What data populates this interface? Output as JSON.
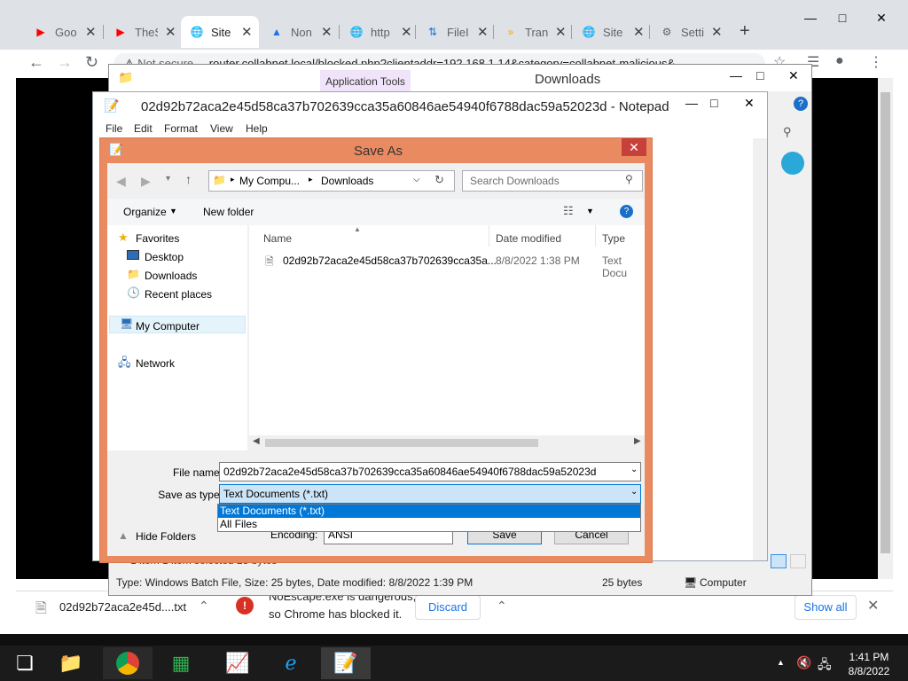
{
  "chrome": {
    "tabs": [
      {
        "title": "Goo",
        "icon": "youtube-icon",
        "color": "#ff0000"
      },
      {
        "title": "TheS",
        "icon": "youtube-icon",
        "color": "#ff0000"
      },
      {
        "title": "Site",
        "icon": "globe-icon",
        "color": "#5f6368"
      },
      {
        "title": "Non",
        "icon": "drive-icon",
        "color": "#1a73e8"
      },
      {
        "title": "http",
        "icon": "globe-icon",
        "color": "#5f6368"
      },
      {
        "title": "FileI",
        "icon": "transfer-icon",
        "color": "#1a73e8"
      },
      {
        "title": "Tran",
        "icon": "chevron-icon",
        "color": "#f9ab00"
      },
      {
        "title": "Site",
        "icon": "globe-icon",
        "color": "#5f6368"
      },
      {
        "title": "Setti",
        "icon": "gear-icon",
        "color": "#5f6368"
      }
    ],
    "security_label": "Not secure",
    "url": "router.collabnet.local/blocked.php?clientaddr=192.168.1.14&category=collabnet-malicious&"
  },
  "downloads_bar": {
    "file_name": "02d92b72aca2e45d....txt",
    "warning_line1": "NoEscape.exe is dangerous,",
    "warning_line2": "so Chrome has blocked it.",
    "discard_label": "Discard",
    "show_all_label": "Show all"
  },
  "explorer": {
    "app_tools_label": "Application Tools",
    "title": "Downloads",
    "status_text": "Type: Windows Batch File, Size: 25 bytes, Date modified: 8/8/2022 1:39 PM",
    "status_size": "25 bytes",
    "status_location": "Computer",
    "behind_text": "1 item     1 item selected  25 bytes"
  },
  "notepad": {
    "title": "02d92b72aca2e45d58ca37b702639cca35a60846ae54940f6788dac59a52023d - Notepad",
    "menus": [
      "File",
      "Edit",
      "Format",
      "View",
      "Help"
    ]
  },
  "save_as": {
    "title": "Save As",
    "breadcrumb": [
      "My Compu...",
      "Downloads"
    ],
    "search_placeholder": "Search Downloads",
    "organize_label": "Organize",
    "new_folder_label": "New folder",
    "nav": {
      "favorites": "Favorites",
      "desktop": "Desktop",
      "downloads": "Downloads",
      "recent": "Recent places",
      "computer": "My Computer",
      "network": "Network"
    },
    "columns": {
      "name": "Name",
      "date": "Date modified",
      "type": "Type"
    },
    "files": [
      {
        "name": "02d92b72aca2e45d58ca37b702639cca35a...",
        "date": "8/8/2022 1:38 PM",
        "type": "Text Docu"
      }
    ],
    "file_name_label": "File name:",
    "file_name_value": "02d92b72aca2e45d58ca37b702639cca35a60846ae54940f6788dac59a52023d",
    "save_type_label": "Save as type:",
    "save_type_value": "Text Documents (*.txt)",
    "save_type_options": [
      "Text Documents (*.txt)",
      "All Files"
    ],
    "encoding_label": "Encoding:",
    "encoding_value": "ANSI",
    "save_label": "Save",
    "cancel_label": "Cancel",
    "hide_folders_label": "Hide Folders"
  },
  "taskbar": {
    "time": "1:41 PM",
    "date": "8/8/2022"
  }
}
